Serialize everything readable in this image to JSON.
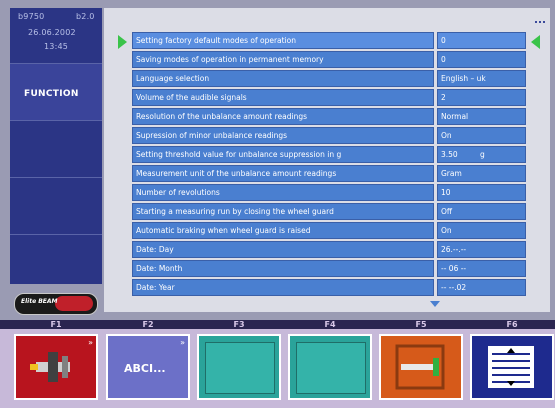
{
  "header": {
    "device_id": "b9750",
    "version": "b2.0",
    "date": "26.06.2002",
    "time": "13:45"
  },
  "sidebar": {
    "function_label": "FUNCTION"
  },
  "logo": {
    "text": "Elite BEAM"
  },
  "settings": [
    {
      "label": "Setting factory default modes of operation",
      "value": "0"
    },
    {
      "label": "Saving modes of operation in permanent memory",
      "value": "0"
    },
    {
      "label": "Language selection",
      "value": "English – uk"
    },
    {
      "label": "Volume of the audible signals",
      "value": "2"
    },
    {
      "label": "Resolution of the unbalance amount readings",
      "value": "Normal"
    },
    {
      "label": "Supression of minor unbalance readings",
      "value": "On"
    },
    {
      "label": "Setting threshold value for unbalance suppression in g",
      "value": "3.50",
      "unit": "g"
    },
    {
      "label": "Measurement unit of the unbalance amount readings",
      "value": "Gram"
    },
    {
      "label": "Number of revolutions",
      "value": "10"
    },
    {
      "label": "Starting a measuring run by closing the wheel guard",
      "value": "Off"
    },
    {
      "label": "Automatic braking when wheel guard is raised",
      "value": "On"
    },
    {
      "label": "Date: Day",
      "value": "26.--.--"
    },
    {
      "label": "Date: Month",
      "value": "-- 06 --"
    },
    {
      "label": "Date: Year",
      "value": "-- --.02"
    }
  ],
  "function_keys": [
    {
      "key": "F1",
      "icon": "wheel-balancer-icon",
      "text": ""
    },
    {
      "key": "F2",
      "icon": "text-input-icon",
      "text": "ABCI..."
    },
    {
      "key": "F3",
      "icon": "blank-panel-icon",
      "text": ""
    },
    {
      "key": "F4",
      "icon": "blank-panel-icon",
      "text": ""
    },
    {
      "key": "F5",
      "icon": "wheel-guard-icon",
      "text": ""
    },
    {
      "key": "F6",
      "icon": "list-adjust-icon",
      "text": ""
    }
  ],
  "colors": {
    "row_fill": "#4a7fd0",
    "sidebar": "#2b3585",
    "selector_arrow": "#3ac34a"
  }
}
